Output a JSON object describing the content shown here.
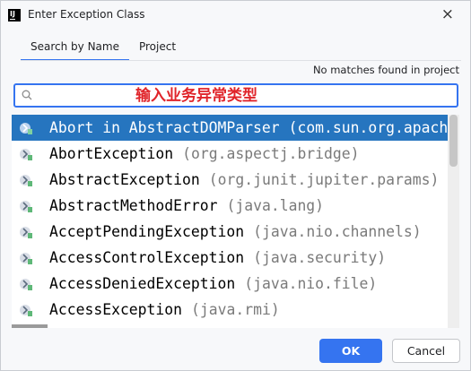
{
  "window": {
    "title": "Enter Exception Class",
    "close_glyph": "×",
    "app_icon": "intellij-icon"
  },
  "tabs": [
    {
      "label": "Search by Name",
      "active": true
    },
    {
      "label": "Project",
      "active": false
    }
  ],
  "status_text": "No matches found in project",
  "search": {
    "value": "输入业务异常类型",
    "icon": "search-icon"
  },
  "results": [
    {
      "name": "Abort in AbstractDOMParser",
      "pkg": "(com.sun.org.apache.xerces.internal.parsers)",
      "selected": true
    },
    {
      "name": "AbortException",
      "pkg": "(org.aspectj.bridge)",
      "selected": false
    },
    {
      "name": "AbstractException",
      "pkg": "(org.junit.jupiter.params)",
      "selected": false
    },
    {
      "name": "AbstractMethodError",
      "pkg": "(java.lang)",
      "selected": false
    },
    {
      "name": "AcceptPendingException",
      "pkg": "(java.nio.channels)",
      "selected": false
    },
    {
      "name": "AccessControlException",
      "pkg": "(java.security)",
      "selected": false
    },
    {
      "name": "AccessDeniedException",
      "pkg": "(java.nio.file)",
      "selected": false
    },
    {
      "name": "AccessException",
      "pkg": "(java.rmi)",
      "selected": false
    }
  ],
  "buttons": {
    "ok": "OK",
    "cancel": "Cancel"
  },
  "colors": {
    "accent": "#3574f0",
    "selection": "#2675bf",
    "search_text": "#e0242a"
  }
}
